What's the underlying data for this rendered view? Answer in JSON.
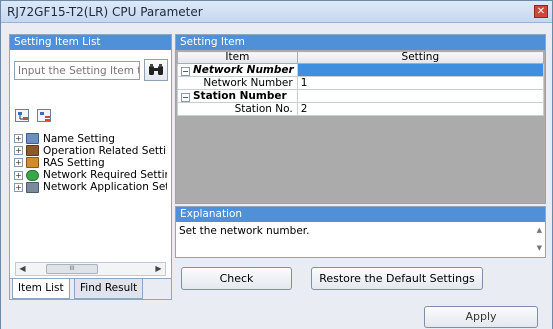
{
  "window": {
    "title": "RJ72GF15-T2(LR) CPU Parameter",
    "close_glyph": "✕"
  },
  "left_panel": {
    "header": "Setting Item List",
    "search_placeholder": "Input the Setting Item to Search",
    "tree": [
      {
        "label": "Name Setting",
        "icon_color": "#6d8fbd"
      },
      {
        "label": "Operation Related Setting",
        "icon_color": "#8a5a2b"
      },
      {
        "label": "RAS Setting",
        "icon_color": "#d08b2a"
      },
      {
        "label": "Network Required Setting",
        "icon_color": "#3aa64a"
      },
      {
        "label": "Network Application Setting",
        "icon_color": "#7a8a9c"
      }
    ],
    "tabs": {
      "item_list": "Item List",
      "find_result": "Find Result"
    },
    "scroll_thumb": "III"
  },
  "right_panel": {
    "header": "Setting Item",
    "columns": {
      "item": "Item",
      "setting": "Setting"
    },
    "rows": [
      {
        "type": "category",
        "item": "Network Number",
        "italic": true,
        "setting": ""
      },
      {
        "type": "child",
        "item": "Network Number",
        "setting": "1"
      },
      {
        "type": "category",
        "item": "Station Number",
        "italic": false,
        "setting": ""
      },
      {
        "type": "child",
        "item": "Station No.",
        "setting": "2"
      }
    ]
  },
  "explanation": {
    "header": "Explanation",
    "text": "Set the network number."
  },
  "buttons": {
    "check": "Check",
    "restore": "Restore the Default Settings",
    "apply": "Apply"
  }
}
